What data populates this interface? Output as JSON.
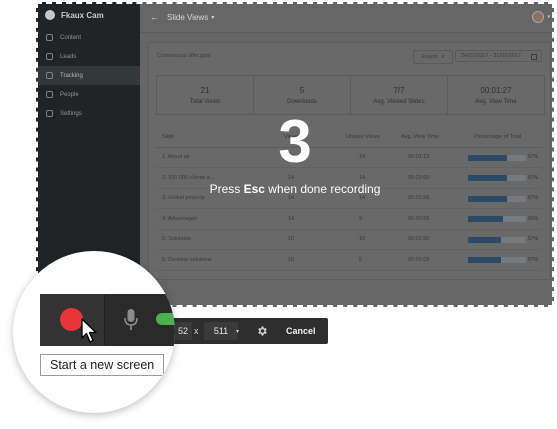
{
  "app": {
    "name": "Fkaux Cam"
  },
  "sidebar": {
    "items": [
      {
        "label": "Content",
        "icon": "content-icon"
      },
      {
        "label": "Leads",
        "icon": "leads-icon"
      },
      {
        "label": "Tracking",
        "icon": "tracking-icon",
        "active": true
      },
      {
        "label": "People",
        "icon": "people-icon"
      },
      {
        "label": "Settings",
        "icon": "settings-icon"
      }
    ]
  },
  "header": {
    "back_icon": "←",
    "title": "Slide Views",
    "caret": "▾",
    "user_caret": "▾"
  },
  "report": {
    "file_name": "Commercial offer.pptx",
    "export_label": "Export",
    "export_caret": "▾",
    "date_range": "24/07/2017 - 31/07/2017"
  },
  "stats": [
    {
      "value": "21",
      "label": "Total Views"
    },
    {
      "value": "5",
      "label": "Downloads"
    },
    {
      "value": "7/7",
      "label": "Avg. Viewed Slides"
    },
    {
      "value": "00:01:27",
      "label": "Avg. View Time"
    }
  ],
  "table": {
    "headers": {
      "slide": "Slide",
      "views": "Views",
      "unique": "Unique Views",
      "avg": "Avg. View Time",
      "pct": "Percentage of Total"
    },
    "rows": [
      {
        "slide": "1. About us",
        "views": "14",
        "unique": "14",
        "avg": "00:01:13",
        "pct": "67%",
        "fill": 0.67
      },
      {
        "slide": "2. 100 000 clients a...",
        "views": "14",
        "unique": "14",
        "avg": "00:02:00",
        "pct": "67%",
        "fill": 0.67
      },
      {
        "slide": "3. Global projects",
        "views": "14",
        "unique": "14",
        "avg": "00:01:56",
        "pct": "67%",
        "fill": 0.67
      },
      {
        "slide": "4. Advantages",
        "views": "14",
        "unique": "9",
        "avg": "00:00:55",
        "pct": "60%",
        "fill": 0.6
      },
      {
        "slide": "5. Solutions",
        "views": "10",
        "unique": "10",
        "avg": "00:02:50",
        "pct": "57%",
        "fill": 0.57
      },
      {
        "slide": "6. Desktop solutions",
        "views": "10",
        "unique": "5",
        "avg": "00:01:09",
        "pct": "57%",
        "fill": 0.57
      }
    ]
  },
  "overlay": {
    "countdown": "3",
    "hint_prefix": "Press ",
    "hint_key": "Esc",
    "hint_suffix": " when done recording"
  },
  "recorder": {
    "width_value": "52",
    "times": "x",
    "height_value": "511",
    "size_caret": "▾",
    "cancel_label": "Cancel",
    "tooltip": "Start a new screen",
    "colors": {
      "record": "#e8343b",
      "toggle": "#4caf50"
    }
  }
}
